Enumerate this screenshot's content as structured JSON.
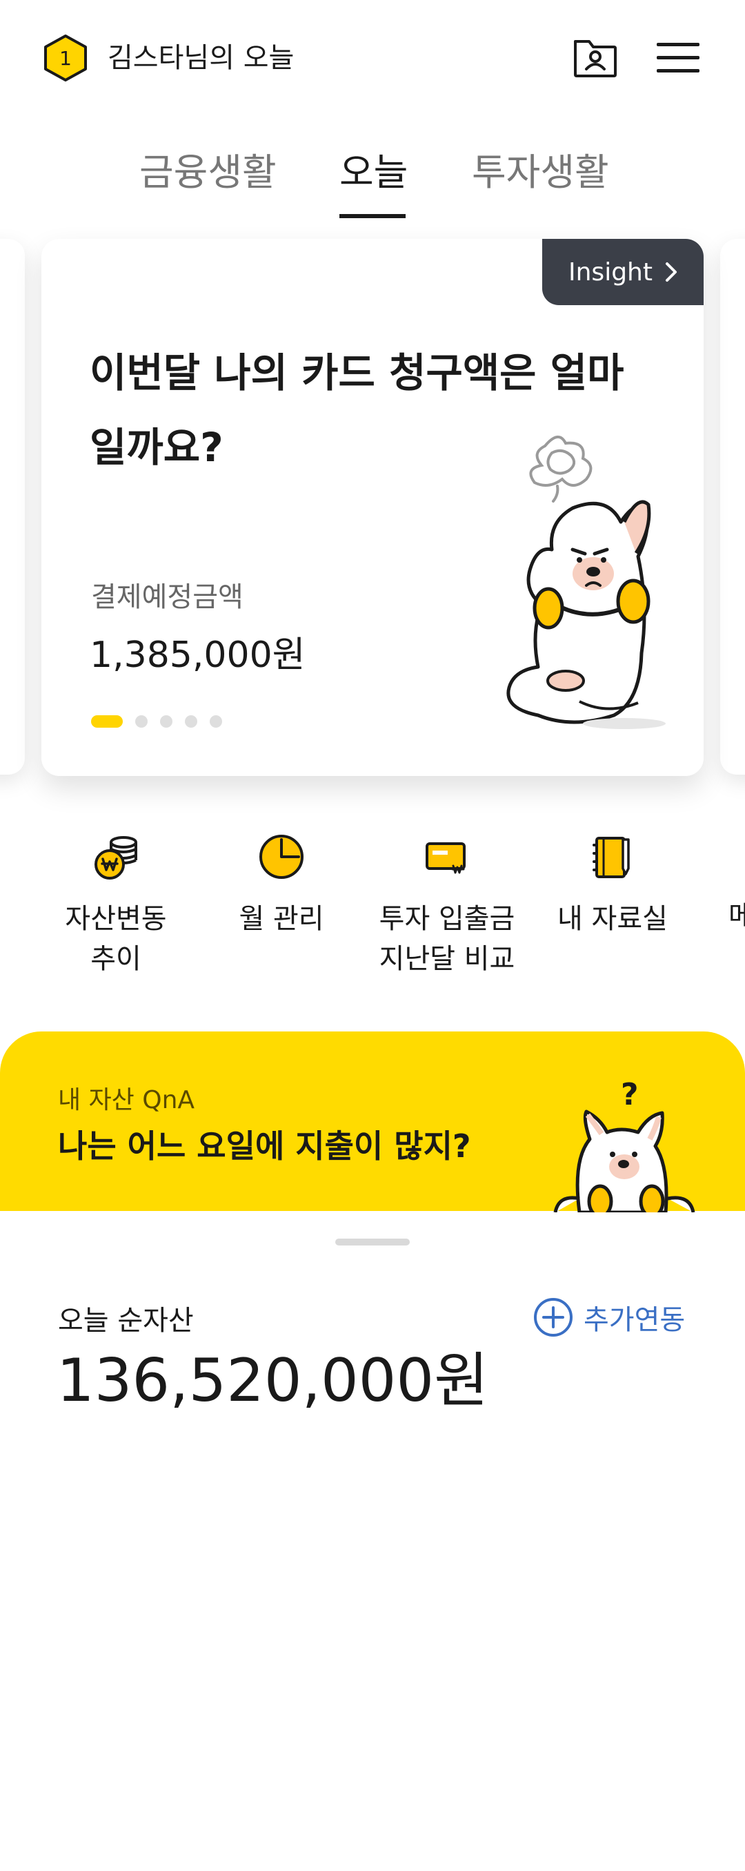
{
  "header": {
    "level": "1",
    "title": "김스타님의 오늘",
    "profile_icon": "profile-folder-icon",
    "menu_icon": "hamburger-menu-icon"
  },
  "tabs": [
    {
      "label": "금융생활",
      "active": false
    },
    {
      "label": "오늘",
      "active": true
    },
    {
      "label": "투자생활",
      "active": false
    }
  ],
  "insight_card": {
    "button_label": "Insight",
    "title": "이번달 나의 카드 청구액은 얼마일까요?",
    "sub_label": "결제예정금액",
    "amount": "1,385,000원",
    "page_count": 5,
    "current_page": 1
  },
  "quick_menu": [
    {
      "icon": "coins-won-icon",
      "label": "자산변동\n추이"
    },
    {
      "icon": "pie-chart-icon",
      "label": "월 관리"
    },
    {
      "icon": "card-won-icon",
      "label": "투자 입출금\n지난달 비교"
    },
    {
      "icon": "notebook-pen-icon",
      "label": "내 자료실"
    },
    {
      "icon": "",
      "label": "메"
    }
  ],
  "qna": {
    "label": "내 자산 QnA",
    "question": "나는 어느 요일에 지출이 많지?"
  },
  "net_assets": {
    "label": "오늘 순자산",
    "value": "136,520,000원",
    "add_link_label": "추가연동"
  },
  "colors": {
    "accent_yellow": "#ffdb00",
    "dark_button": "#3b3f48",
    "link_blue": "#3a6fc4"
  }
}
